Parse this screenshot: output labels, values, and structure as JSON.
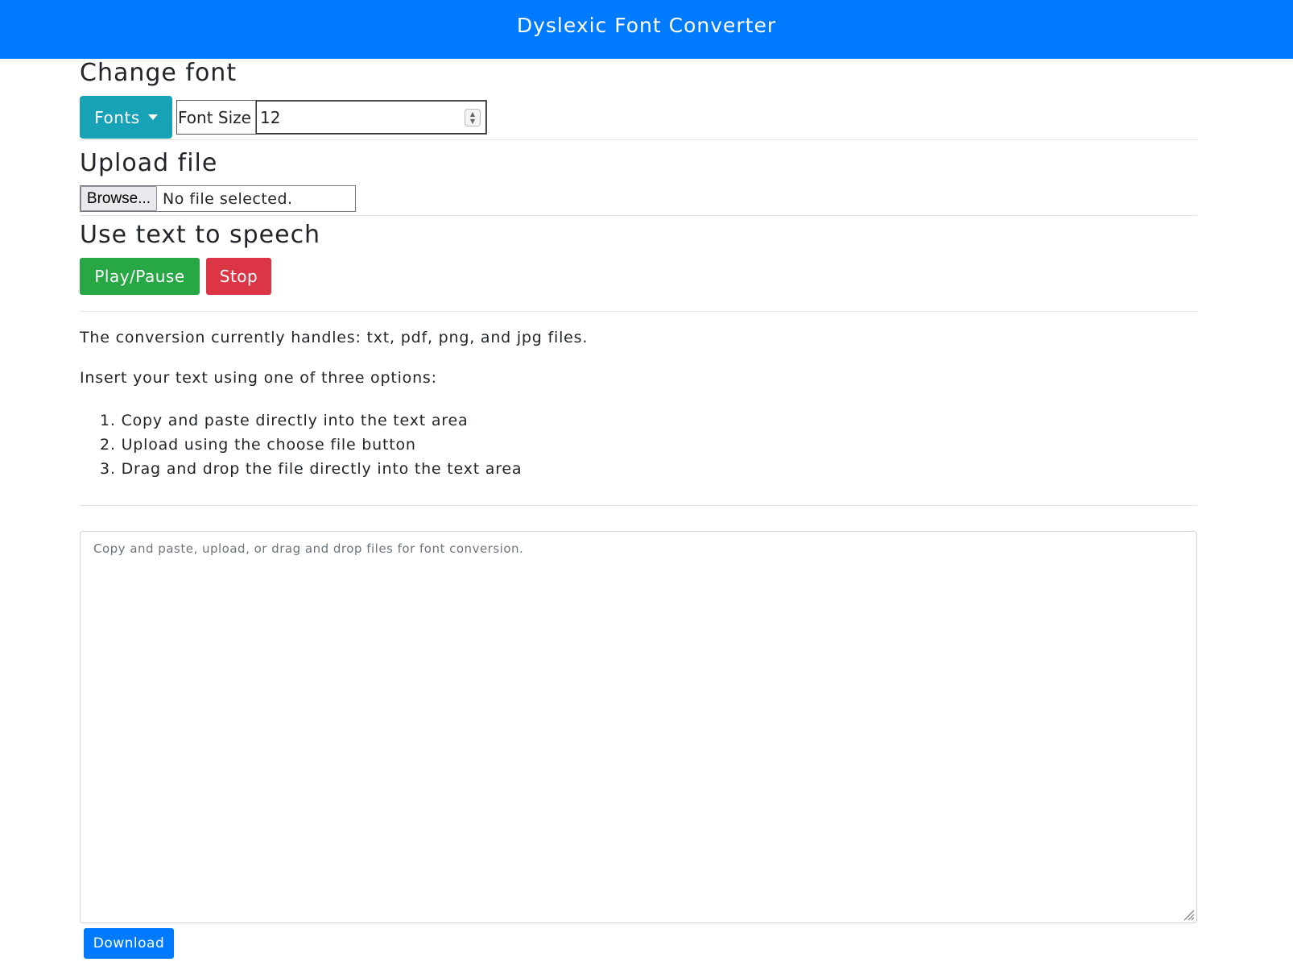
{
  "navbar": {
    "title": "Dyslexic Font Converter"
  },
  "change_font": {
    "heading": "Change font",
    "fonts_button": "Fonts",
    "font_size_label": "Font Size",
    "font_size_value": "12"
  },
  "upload": {
    "heading": "Upload file",
    "browse_label": "Browse...",
    "status": "No file selected."
  },
  "tts": {
    "heading": "Use text to speech",
    "play_label": "Play/Pause",
    "stop_label": "Stop"
  },
  "info": {
    "formats": "The conversion currently handles: txt, pdf, png, and jpg files.",
    "intro": "Insert your text using one of three options:",
    "options": [
      "1. Copy and paste directly into the text area",
      "2. Upload using the choose file button",
      "3. Drag and drop the file directly into the text area"
    ]
  },
  "editor": {
    "placeholder": "Copy and paste, upload, or drag and drop files for font conversion."
  },
  "download": {
    "label": "Download"
  },
  "colors": {
    "navbar": "#007bff",
    "fonts_button": "#17a2b8",
    "play_button": "#28a745",
    "stop_button": "#dc3545",
    "download_button": "#007bff"
  }
}
